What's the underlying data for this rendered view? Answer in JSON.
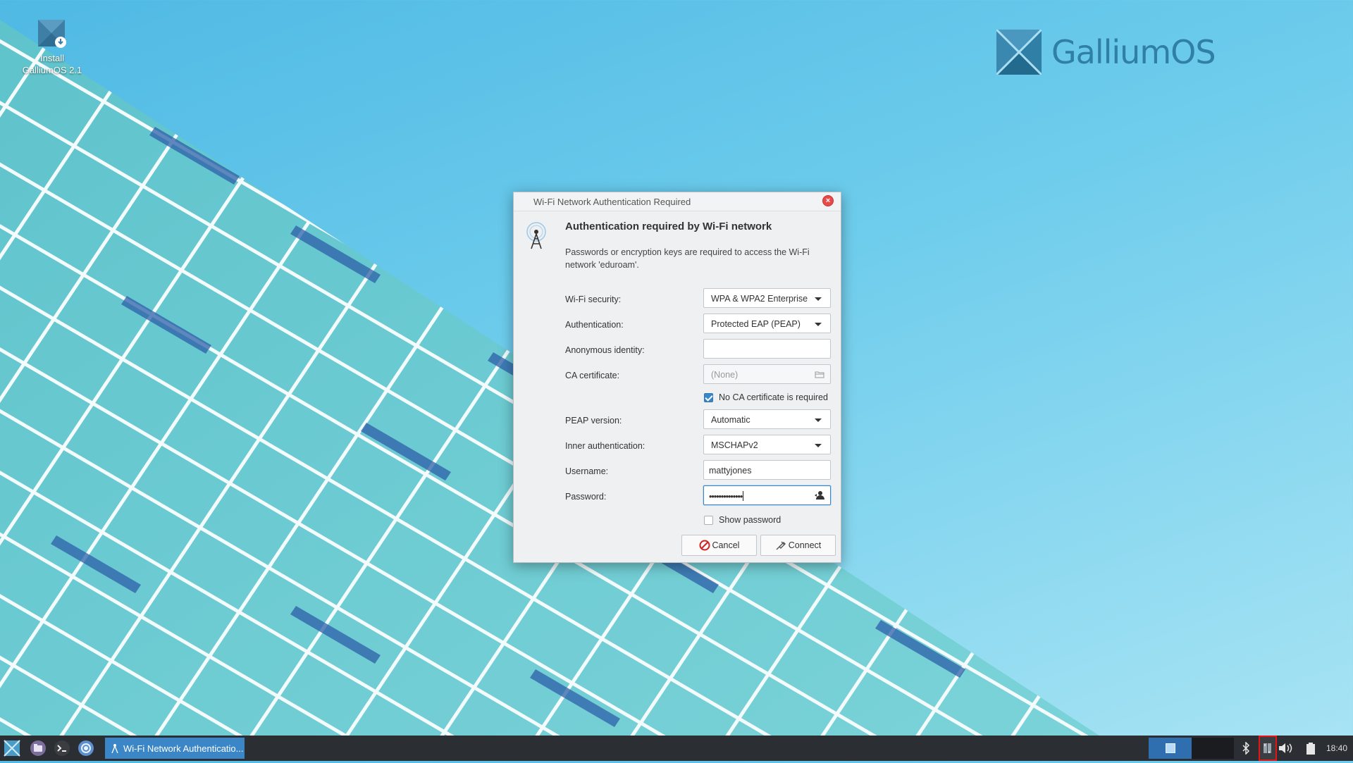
{
  "desktop": {
    "icon_label": "Install\nGalliumOS 2.1",
    "logo_text": "GalliumOS"
  },
  "dialog": {
    "window_title": "Wi-Fi Network Authentication Required",
    "heading": "Authentication required by Wi-Fi network",
    "description": "Passwords or encryption keys are required to access the Wi-Fi network 'eduroam'.",
    "fields": {
      "wifi_security": {
        "label": "Wi-Fi security:",
        "value": "WPA & WPA2 Enterprise"
      },
      "authentication": {
        "label": "Authentication:",
        "value": "Protected EAP (PEAP)"
      },
      "anonymous_identity": {
        "label": "Anonymous identity:",
        "value": ""
      },
      "ca_certificate": {
        "label": "CA certificate:",
        "value": "(None)"
      },
      "no_ca_required": {
        "label": "No CA certificate is required",
        "checked": true
      },
      "peap_version": {
        "label": "PEAP version:",
        "value": "Automatic"
      },
      "inner_authentication": {
        "label": "Inner authentication:",
        "value": "MSCHAPv2"
      },
      "username": {
        "label": "Username:",
        "value": "mattyjones"
      },
      "password": {
        "label": "Password:",
        "value": "••••••••••••••"
      },
      "show_password": {
        "label": "Show password",
        "checked": false
      }
    },
    "buttons": {
      "cancel": "Cancel",
      "connect": "Connect"
    }
  },
  "taskbar": {
    "active_task": "Wi-Fi Network Authenticatio...",
    "clock": "18:40",
    "launchers": [
      "galliumos-menu-icon",
      "files-icon",
      "terminal-icon",
      "chromium-icon"
    ],
    "tray_icons": [
      "bluetooth-icon",
      "network-icon",
      "volume-icon",
      "battery-icon"
    ]
  },
  "colors": {
    "accent": "#3b86c6",
    "taskbar": "#2b2f33",
    "highlight_border": "#e41515",
    "close_button": "#e84a4a"
  }
}
